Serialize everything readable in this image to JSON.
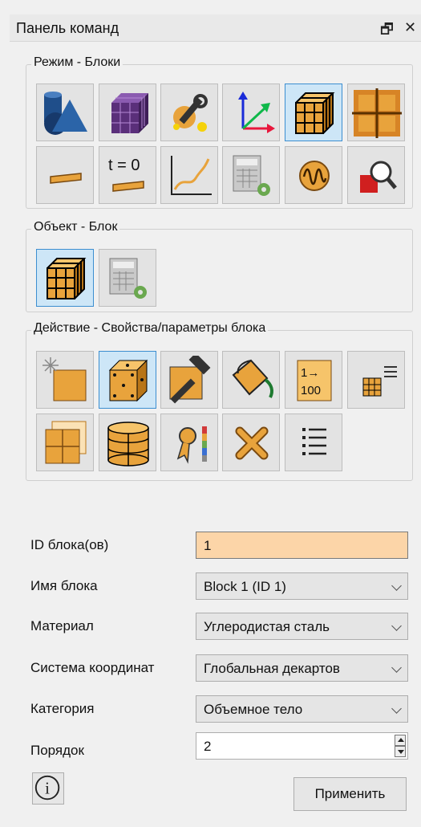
{
  "panel": {
    "title": "Панель команд"
  },
  "groups": {
    "mode": "Режим - Блоки",
    "object": "Объект - Блок",
    "action": "Действие - Свойства/параметры блока"
  },
  "mode_icons": [
    "geometry-icon",
    "mesh-icon",
    "tools-icon",
    "axes-icon",
    "block-icon",
    "grid-icon",
    "load-icon",
    "initial-condition-icon",
    "curve-icon",
    "calculator-icon",
    "wave-icon",
    "inspect-icon"
  ],
  "mode_t0": "t = 0",
  "action_numbering": {
    "top": "1→",
    "bottom": "100"
  },
  "form": {
    "id_label": "ID блока(ов)",
    "id_value": "1",
    "name_label": "Имя блока",
    "name_value": "Block 1 (ID 1)",
    "material_label": "Материал",
    "material_value": "Углеродистая сталь",
    "coord_label": "Система координат",
    "coord_value": "Глобальная декартов",
    "category_label": "Категория",
    "category_value": "Объемное тело",
    "order_label": "Порядок",
    "order_value": "2"
  },
  "buttons": {
    "apply": "Применить",
    "info": "i"
  },
  "colors": {
    "accent": "#3c8ed0",
    "highlight": "#fcd5a8",
    "block": "#e8a33c"
  }
}
